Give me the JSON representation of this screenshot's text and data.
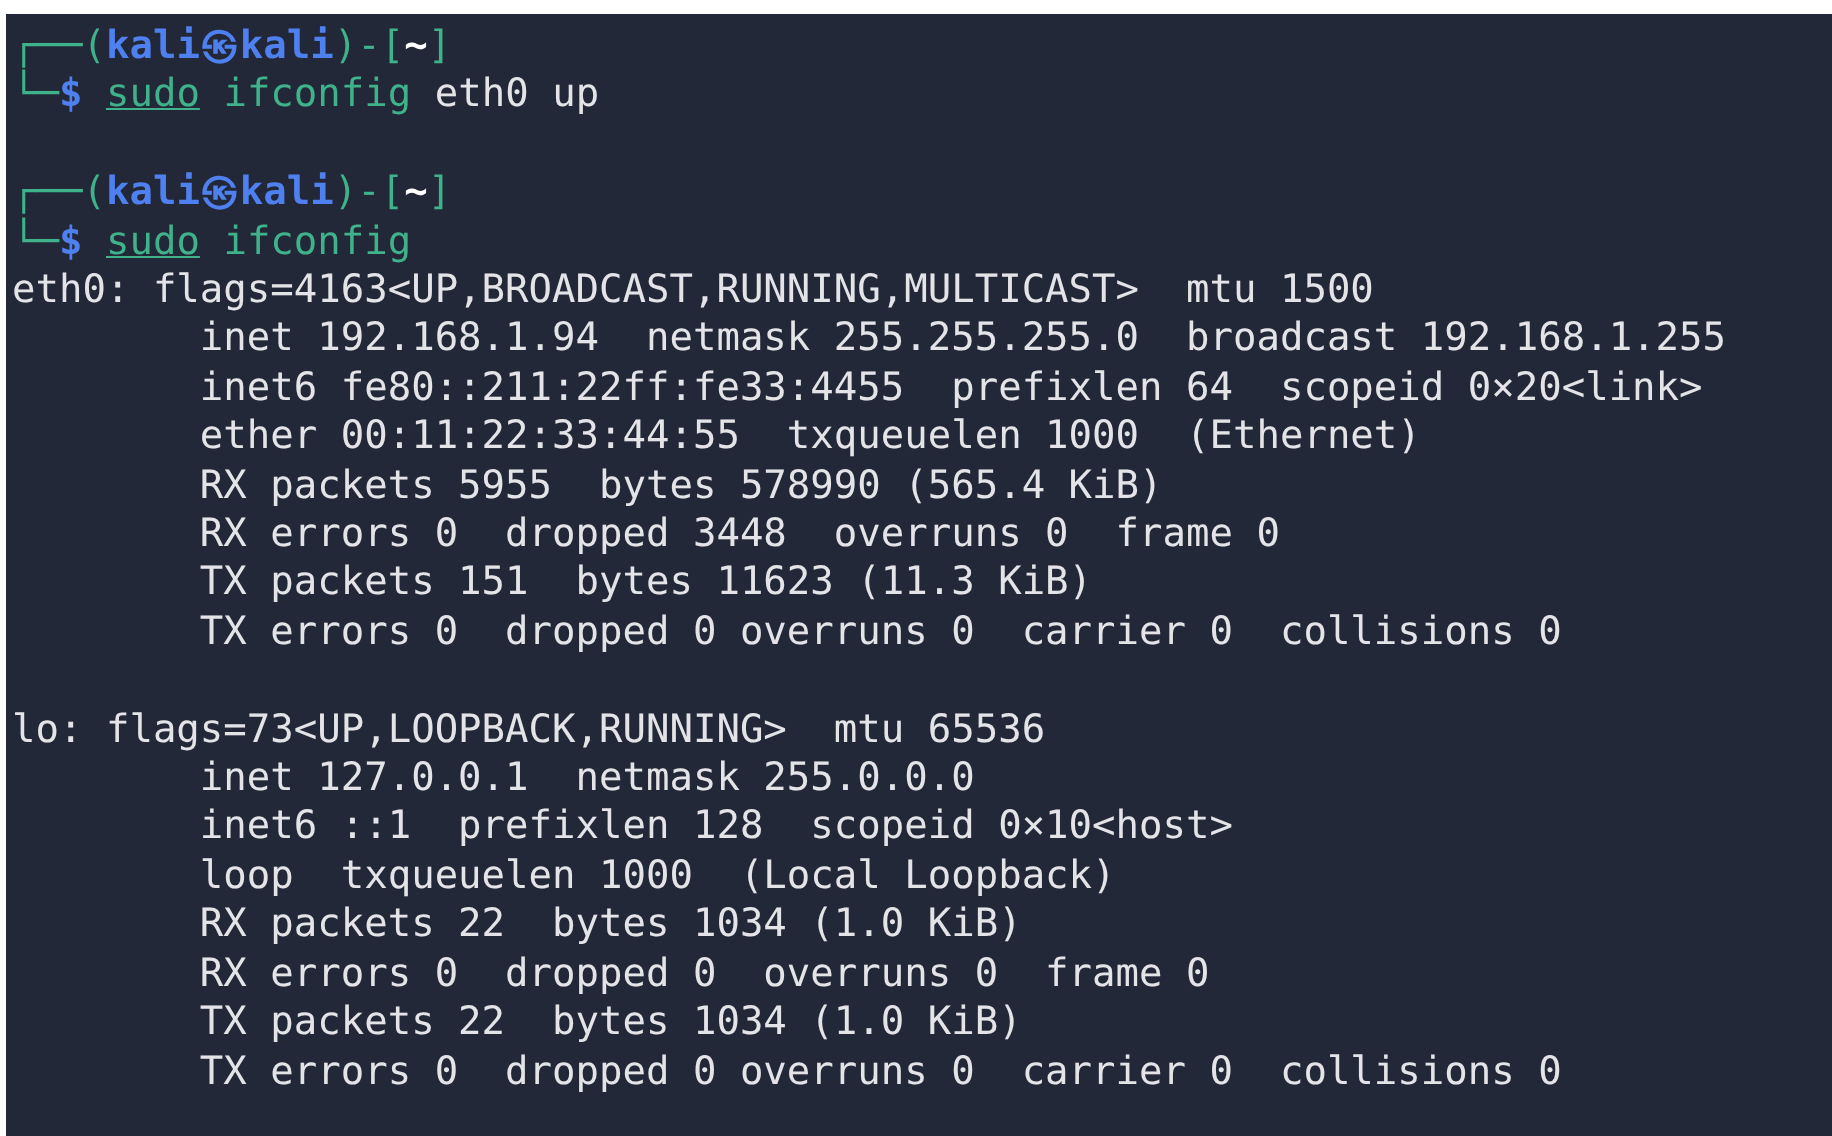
{
  "terminal": {
    "entries": [
      {
        "kind": "prompt",
        "frame_open": "┌──(",
        "user": "kali㉿kali",
        "frame_mid": ")-[",
        "path": "~",
        "frame_close": "]",
        "frame_cmd": "└─",
        "dollar": "$",
        "sudo": "sudo",
        "program": "ifconfig",
        "args": "eth0 up"
      },
      {
        "kind": "blank"
      },
      {
        "kind": "prompt",
        "frame_open": "┌──(",
        "user": "kali㉿kali",
        "frame_mid": ")-[",
        "path": "~",
        "frame_close": "]",
        "frame_cmd": "└─",
        "dollar": "$",
        "sudo": "sudo",
        "program": "ifconfig"
      },
      {
        "kind": "output",
        "text": "eth0: flags=4163<UP,BROADCAST,RUNNING,MULTICAST>  mtu 1500"
      },
      {
        "kind": "output",
        "text": "        inet 192.168.1.94  netmask 255.255.255.0  broadcast 192.168.1.255"
      },
      {
        "kind": "output",
        "text": "        inet6 fe80::211:22ff:fe33:4455  prefixlen 64  scopeid 0×20<link>"
      },
      {
        "kind": "output",
        "text": "        ether 00:11:22:33:44:55  txqueuelen 1000  (Ethernet)"
      },
      {
        "kind": "output",
        "text": "        RX packets 5955  bytes 578990 (565.4 KiB)"
      },
      {
        "kind": "output",
        "text": "        RX errors 0  dropped 3448  overruns 0  frame 0"
      },
      {
        "kind": "output",
        "text": "        TX packets 151  bytes 11623 (11.3 KiB)"
      },
      {
        "kind": "output",
        "text": "        TX errors 0  dropped 0 overruns 0  carrier 0  collisions 0"
      },
      {
        "kind": "blank"
      },
      {
        "kind": "output",
        "text": "lo: flags=73<UP,LOOPBACK,RUNNING>  mtu 65536"
      },
      {
        "kind": "output",
        "text": "        inet 127.0.0.1  netmask 255.0.0.0"
      },
      {
        "kind": "output",
        "text": "        inet6 ::1  prefixlen 128  scopeid 0×10<host>"
      },
      {
        "kind": "output",
        "text": "        loop  txqueuelen 1000  (Local Loopback)"
      },
      {
        "kind": "output",
        "text": "        RX packets 22  bytes 1034 (1.0 KiB)"
      },
      {
        "kind": "output",
        "text": "        RX errors 0  dropped 0  overruns 0  frame 0"
      },
      {
        "kind": "output",
        "text": "        TX packets 22  bytes 1034 (1.0 KiB)"
      },
      {
        "kind": "output",
        "text": "        TX errors 0  dropped 0 overruns 0  carrier 0  collisions 0"
      }
    ]
  }
}
